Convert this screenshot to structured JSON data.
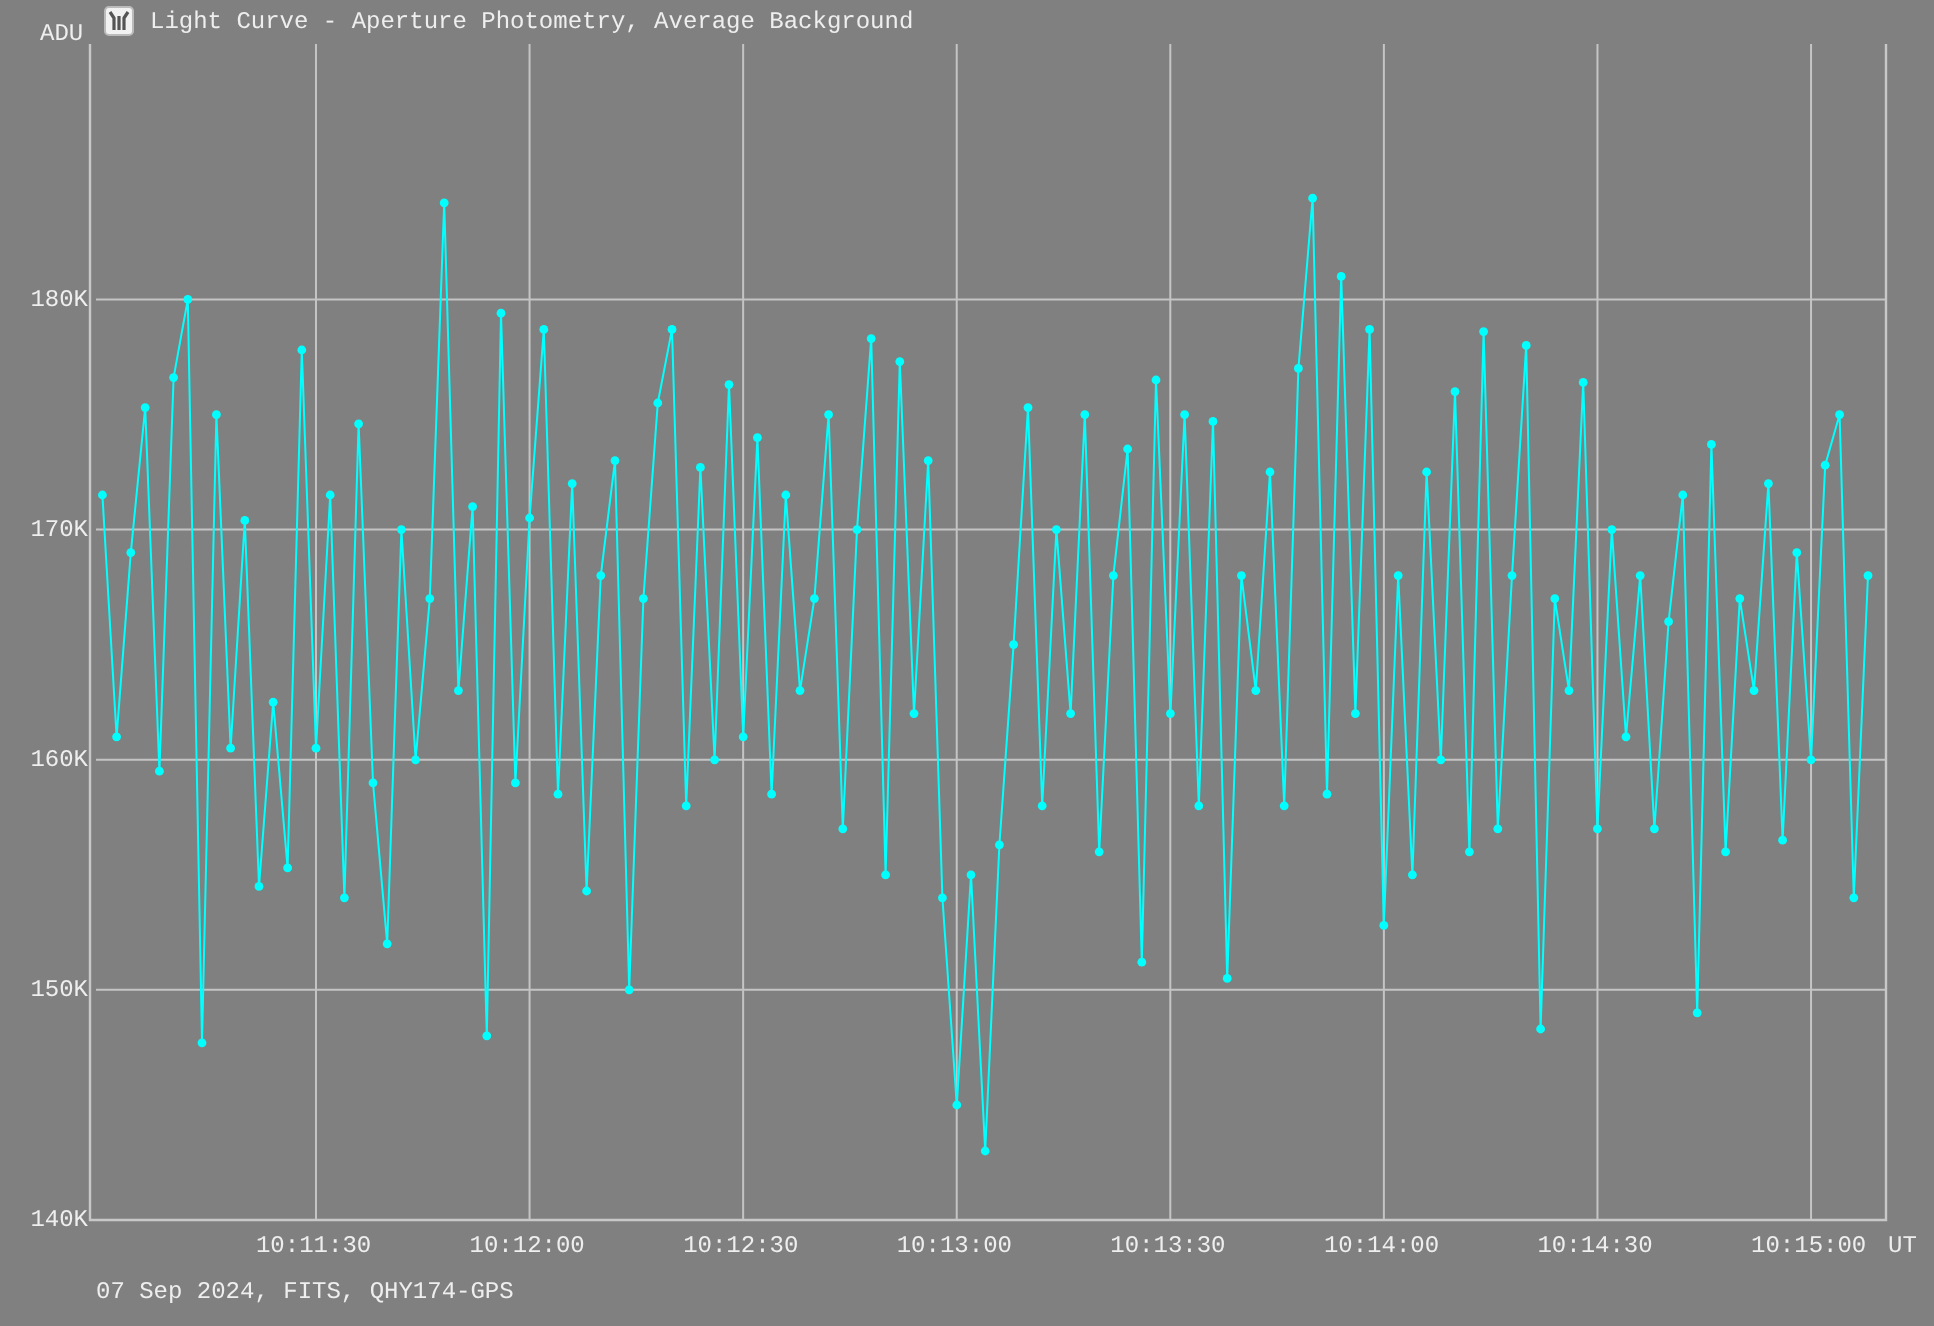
{
  "window": {
    "title": "Light Curve - Aperture Photometry, Average Background"
  },
  "plot": {
    "xunit": "UT",
    "chart_data": {
      "type": "line",
      "ylabel": "ADU",
      "grid": true,
      "ylim": [
        140,
        191.1
      ],
      "yticks": [
        {
          "value": 180,
          "label": "180K"
        },
        {
          "value": 170,
          "label": "170K"
        },
        {
          "value": 160,
          "label": "160K"
        },
        {
          "value": 150,
          "label": "150K"
        },
        {
          "value": 140,
          "label": "140K"
        }
      ],
      "categories": [
        null,
        null,
        null,
        null,
        null,
        null,
        null,
        null,
        null,
        null,
        null,
        null,
        null,
        null,
        null,
        "10:11:30",
        null,
        null,
        null,
        null,
        null,
        null,
        null,
        null,
        null,
        null,
        null,
        null,
        null,
        null,
        "10:12:00",
        null,
        null,
        null,
        null,
        null,
        null,
        null,
        null,
        null,
        null,
        null,
        null,
        null,
        null,
        "10:12:30",
        null,
        null,
        null,
        null,
        null,
        null,
        null,
        null,
        null,
        null,
        null,
        null,
        null,
        null,
        "10:13:00",
        null,
        null,
        null,
        null,
        null,
        null,
        null,
        null,
        null,
        null,
        null,
        null,
        null,
        null,
        "10:13:30",
        null,
        null,
        null,
        null,
        null,
        null,
        null,
        null,
        null,
        null,
        null,
        null,
        null,
        null,
        "10:14:00",
        null,
        null,
        null,
        null,
        null,
        null,
        null,
        null,
        null,
        null,
        null,
        null,
        null,
        null,
        "10:14:30",
        null,
        null,
        null,
        null,
        null,
        null,
        null,
        null,
        null,
        null,
        null,
        null,
        null,
        null,
        "10:15:00",
        null,
        null,
        null,
        null
      ],
      "series": [
        {
          "color": "#00ffff",
          "marker": "circle",
          "values": [
            171.5,
            161,
            169,
            175.3,
            159.5,
            176.6,
            180,
            147.7,
            175,
            160.5,
            170.4,
            154.5,
            162.5,
            155.3,
            177.8,
            160.5,
            171.5,
            154,
            174.6,
            159,
            152,
            170,
            160,
            167,
            184.2,
            163,
            171,
            148,
            179.4,
            159,
            170.5,
            178.7,
            158.5,
            172,
            154.3,
            168,
            173,
            150,
            167,
            175.5,
            178.7,
            158,
            172.7,
            160,
            176.3,
            161,
            174,
            158.5,
            171.5,
            163,
            167,
            175,
            157,
            170,
            178.3,
            155,
            177.3,
            162,
            173,
            154,
            145,
            155,
            143,
            156.3,
            165,
            175.3,
            158,
            170,
            162,
            175,
            156,
            168,
            173.5,
            151.2,
            176.5,
            162,
            175,
            158,
            174.7,
            150.5,
            168,
            163,
            172.5,
            158,
            177,
            184.4,
            158.5,
            181,
            162,
            178.7,
            152.8,
            168,
            155,
            172.5,
            160,
            176,
            156,
            178.6,
            157,
            168,
            178,
            148.3,
            167,
            163,
            176.4,
            157,
            170,
            161,
            168,
            157,
            166,
            171.5,
            149,
            173.7,
            156,
            167,
            163,
            172,
            156.5,
            169,
            160,
            172.8,
            175,
            154,
            168
          ]
        }
      ]
    }
  },
  "footer": "07 Sep 2024, FITS, QHY174-GPS"
}
